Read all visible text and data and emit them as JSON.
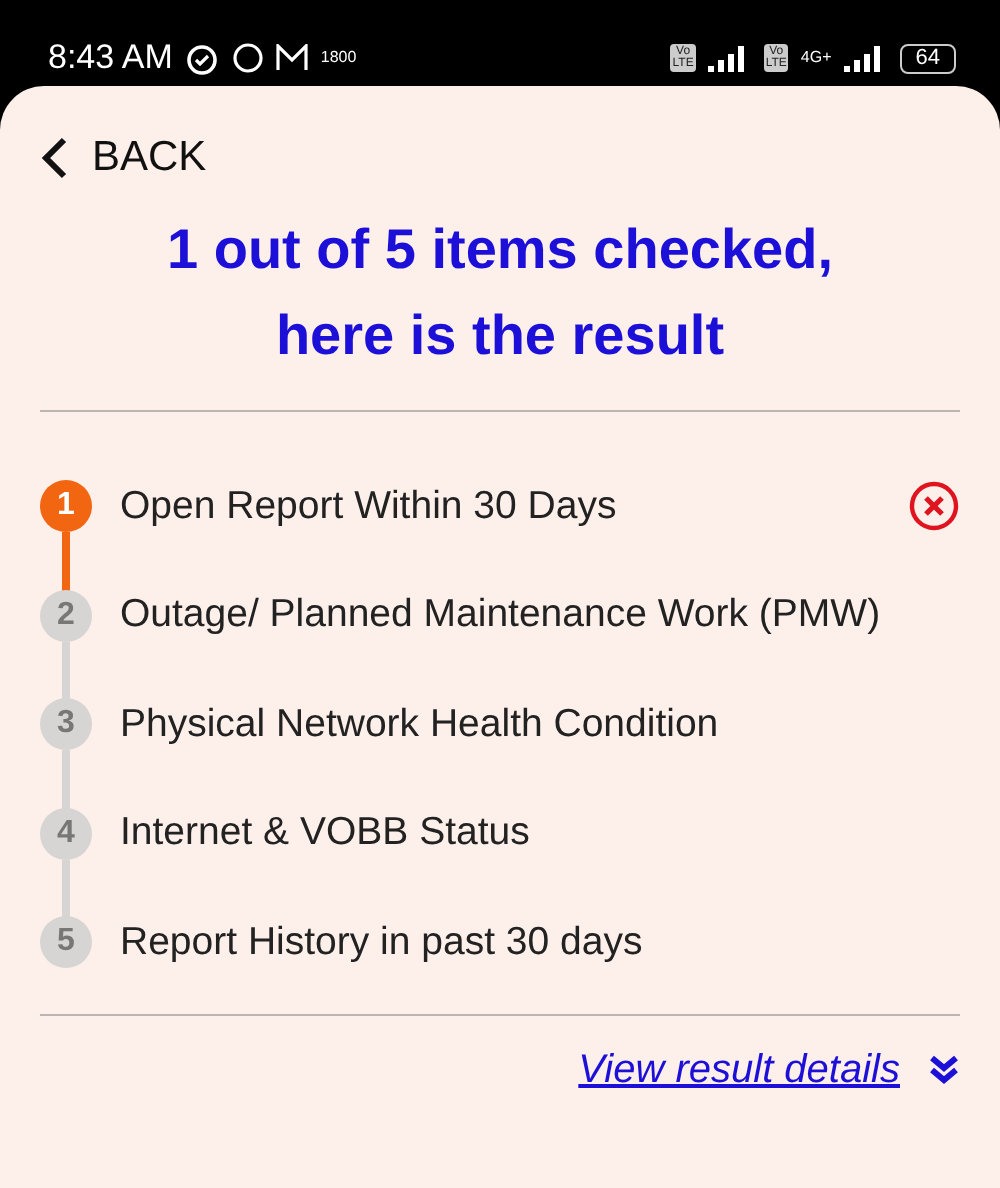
{
  "status_bar": {
    "time": "8:43 AM",
    "hotspot_band": "1800",
    "sim_labels": [
      {
        "top": "Vo",
        "bottom": "LTE"
      },
      {
        "top": "Vo",
        "bottom": "LTE"
      }
    ],
    "network_type": "4G+",
    "battery": "64"
  },
  "back": {
    "label": "BACK"
  },
  "title": "1 out of 5 items checked, here is the result",
  "steps": [
    {
      "number": "1",
      "label": "Open Report Within 30 Days",
      "kind": "failed"
    },
    {
      "number": "2",
      "label": "Outage/ Planned Maintenance Work (PMW)",
      "kind": "pending"
    },
    {
      "number": "3",
      "label": "Physical Network Health Condition",
      "kind": "pending"
    },
    {
      "number": "4",
      "label": "Internet & VOBB Status",
      "kind": "pending"
    },
    {
      "number": "5",
      "label": "Report History in past 30 days",
      "kind": "pending"
    }
  ],
  "details_link": {
    "label": "View result details",
    "expanded": false
  }
}
